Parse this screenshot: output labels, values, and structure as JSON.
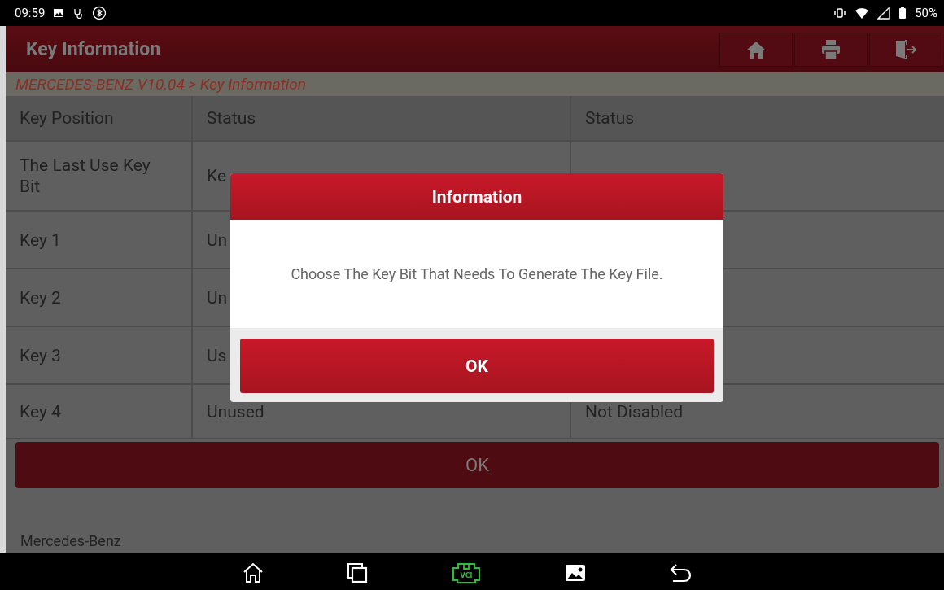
{
  "status_bar": {
    "time": "09:59",
    "battery": "50%"
  },
  "header": {
    "title": "Key Information"
  },
  "breadcrumb": "MERCEDES-BENZ V10.04 > Key Information",
  "table": {
    "columns": [
      "Key Position",
      "Status",
      "Status"
    ],
    "rows": [
      [
        "The Last Use Key Bit",
        "Ke",
        ""
      ],
      [
        "Key 1",
        "Un",
        ""
      ],
      [
        "Key 2",
        "Un",
        ""
      ],
      [
        "Key 3",
        "Us",
        ""
      ],
      [
        "Key 4",
        "Unused",
        "Not Disabled"
      ]
    ]
  },
  "ok_button": "OK",
  "footer_text": "Mercedes-Benz",
  "nav_bar": {
    "vci_label": "VCI"
  },
  "dialog": {
    "title": "Information",
    "message": "Choose The Key Bit That Needs To Generate The Key File.",
    "button": "OK"
  }
}
